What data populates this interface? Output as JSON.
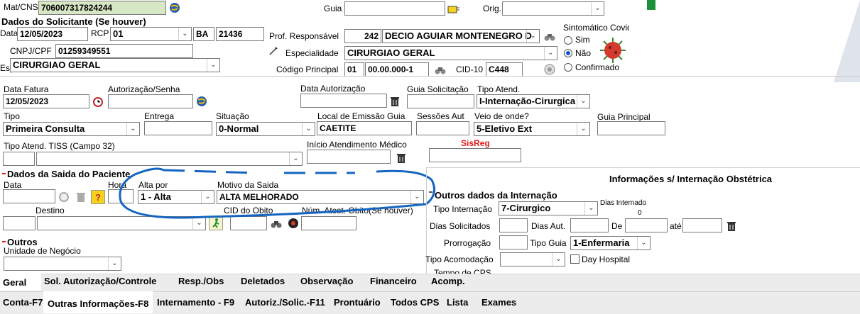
{
  "mat_cns": {
    "label": "Mat/CNS",
    "value": "706007317824244"
  },
  "guia": {
    "label": "Guia",
    "value": ""
  },
  "orig": {
    "label": "Orig.",
    "value": ""
  },
  "solicitante": {
    "title": "Dados do Solicitante (Se houver)",
    "data_label": "Data",
    "data_value": "12/05/2023",
    "rcp_label": "RCP",
    "rcp_value": "01",
    "uf_value": "BA",
    "crm_value": "21436",
    "cnpj_label": "CNPJ/CPF",
    "cnpj_value": "01259349551",
    "esp_label": "Esp",
    "esp_value": "CIRURGIAO GERAL"
  },
  "prof": {
    "label": "Prof. Responsável",
    "code": "242",
    "name": "DECIO AGUIAR MONTENEGRO D",
    "esp_label": "Especialidade",
    "esp_value": "CIRURGIAO GERAL",
    "cod_label": "Código Principal",
    "cod_prefix": "01",
    "cod_value": "00.00.000-1",
    "cid_label": "CID-10",
    "cid_value": "C448"
  },
  "covid": {
    "title": "Sintomático Covid",
    "options": [
      "Sim",
      "Não",
      "Confirmado"
    ],
    "selected": "Não"
  },
  "fatura": {
    "label": "Data Fatura",
    "value": "12/05/2023"
  },
  "autorizacao": {
    "label": "Autorização/Senha",
    "value": ""
  },
  "data_aut": {
    "label": "Data Autorização",
    "value": ""
  },
  "guia_sol": {
    "label": "Guia Solicitação",
    "value": ""
  },
  "tipo_atend": {
    "label": "Tipo Atend.",
    "value": "I-Internação-Cirurgica"
  },
  "tipo": {
    "label": "Tipo",
    "value": "Primeira Consulta"
  },
  "entrega": {
    "label": "Entrega",
    "value": ""
  },
  "situacao": {
    "label": "Situação",
    "value": "0-Normal"
  },
  "local_emissao": {
    "label": "Local de Emissão Guia",
    "value": "CAETITE"
  },
  "sessoes": {
    "label": "Sessões Aut",
    "value": ""
  },
  "veio": {
    "label": "Veio de onde?",
    "value": "5-Eletivo Ext"
  },
  "guia_principal": {
    "label": "Guia Principal",
    "value": ""
  },
  "tiss": {
    "label": "Tipo Atend. TISS (Campo 32)",
    "value": ""
  },
  "inicio": {
    "label": "Início Atendimento Médico",
    "value": ""
  },
  "sisreg": {
    "label": "SisReg",
    "value": ""
  },
  "saida": {
    "title": "Dados da Saida do Paciente",
    "data_label": "Data",
    "hora_label": "Hora",
    "alta_label": "Alta por",
    "alta_value": "1 - Alta",
    "motivo_label": "Motivo da Saida",
    "motivo_value": "ALTA MELHORADO",
    "destino_label": "Destino",
    "cid_obito_label": "CID do Obito",
    "num_atest_label": "Núm. Atest. Obito(Se houver)"
  },
  "obstetrica": {
    "title": "Informações s/ Internação Obstétrica"
  },
  "internacao": {
    "title": "Outros dados da Internação",
    "tipo_label": "Tipo Internação",
    "tipo_value": "7-Cirurgico",
    "dias_int_label": "Dias Internado",
    "dias_int_value": "0",
    "dias_sol_label": "Dias Solicitados",
    "dias_aut_label": "Dias Aut.",
    "de_label": "De",
    "ate_label": "até",
    "prorrogacao_label": "Prorrogação",
    "tipo_guia_label": "Tipo Guia",
    "tipo_guia_value": "1-Enfermaria",
    "acomodacao_label": "Tipo Acomodação",
    "day_hospital_label": "Day Hospital",
    "partial_label": "Tempo de CPS"
  },
  "outros": {
    "title": "Outros",
    "unidade_label": "Unidade de Negócio",
    "unidade_value": ""
  },
  "tabs_top": [
    "Geral",
    "Sol. Autorização/Controle",
    "Resp./Obs",
    "Deletados",
    "Observação",
    "Financeiro",
    "Acomp."
  ],
  "tabs_bottom": [
    "Conta-F7",
    "Outras Informações-F8",
    "Internamento - F9",
    "Autoriz./Solic.-F11",
    "Prontuário",
    "Todos CPS",
    "Lista",
    "Exames"
  ],
  "colors": {
    "field_green": "#d7e7c5",
    "annotation_blue": "#1565c0",
    "sisreg_red": "#e01a1a",
    "tab_bar": "#ececec"
  }
}
